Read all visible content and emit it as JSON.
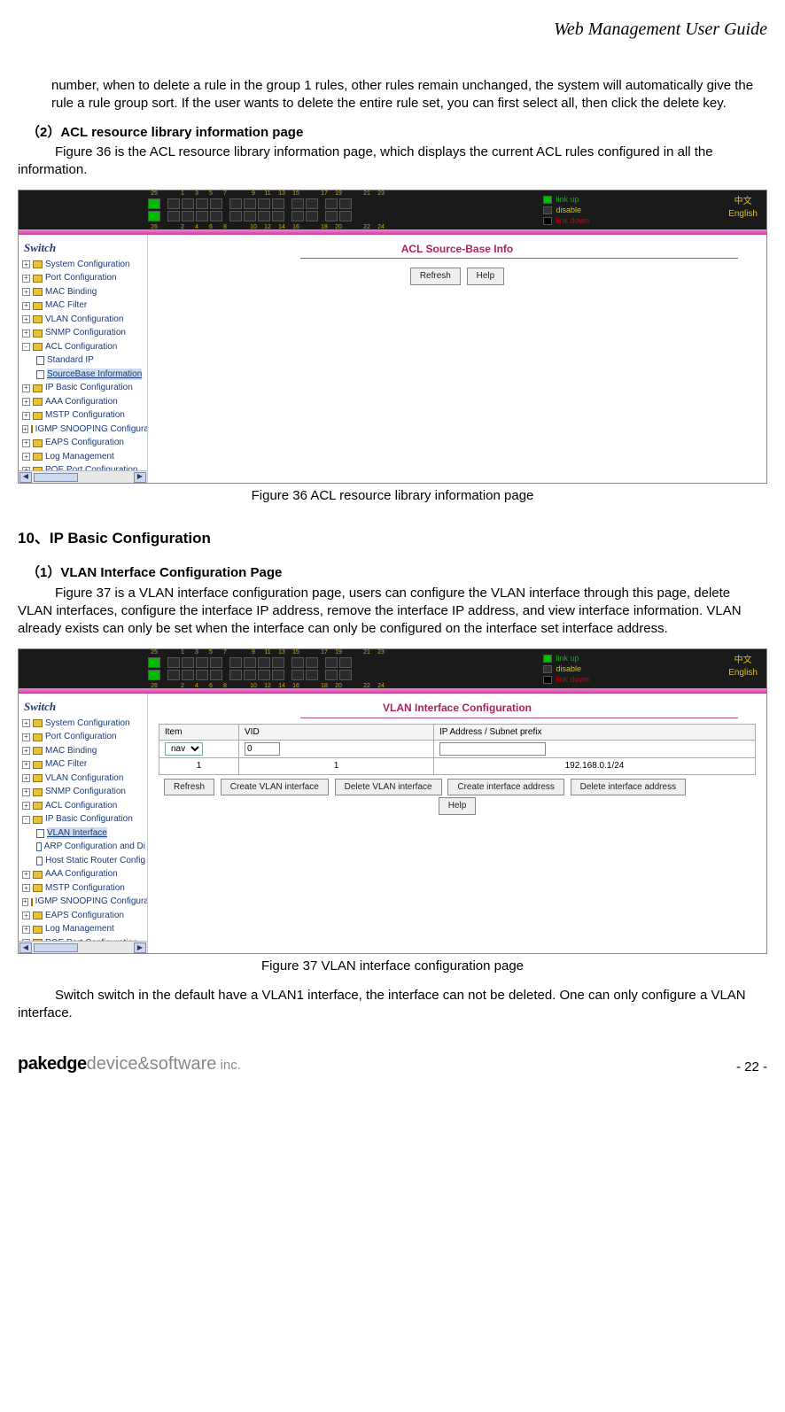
{
  "header": {
    "title": "Web Management User Guide"
  },
  "paragraphs": {
    "intro_cont": "number, when to delete a rule in the group 1 rules, other rules remain unchanged, the system will automatically give the rule a rule group sort. If the user wants to delete the entire rule set, you can first select all, then click the delete key.",
    "sec2_heading": "（2）ACL resource library information page",
    "sec2_body": "Figure 36 is the ACL resource library information page, which displays the current ACL rules configured in all the information.",
    "fig36_caption": "Figure 36    ACL resource library information page",
    "sec10_heading": "10、IP Basic Configuration",
    "sec10_1_heading": "（1）VLAN Interface Configuration Page",
    "sec10_1_body": "Figure 37 is a VLAN interface configuration page, users can configure the VLAN interface through this page, delete VLAN interfaces, configure the interface IP address, remove the interface IP address, and view interface information. VLAN already exists can only be set when the interface can only be configured on the interface set interface address.",
    "fig37_caption": "Figure 37    VLAN interface configuration page",
    "closing": "Switch switch in the default have a VLAN1 interface, the interface can not be deleted. One can only configure a VLAN interface."
  },
  "embedded_common": {
    "port_top_nums": [
      "25",
      "",
      "1",
      "3",
      "5",
      "7",
      "",
      "9",
      "11",
      "13",
      "15",
      "",
      "17",
      "19",
      "",
      "21",
      "23"
    ],
    "port_bot_nums": [
      "26",
      "",
      "2",
      "4",
      "6",
      "8",
      "",
      "10",
      "12",
      "14",
      "16",
      "",
      "18",
      "20",
      "",
      "22",
      "24"
    ],
    "legend": {
      "up": "link up",
      "disable": "disable",
      "down": "link down"
    },
    "lang_cn": "中文",
    "lang_en": "English",
    "sidebar_title": "Switch"
  },
  "fig36": {
    "panel_title": "ACL Source-Base Info",
    "buttons": {
      "refresh": "Refresh",
      "help": "Help"
    },
    "sidebar": [
      {
        "t": "folder",
        "exp": "+",
        "label": "System Configuration"
      },
      {
        "t": "folder",
        "exp": "+",
        "label": "Port Configuration"
      },
      {
        "t": "folder",
        "exp": "+",
        "label": "MAC Binding"
      },
      {
        "t": "folder",
        "exp": "+",
        "label": "MAC Filter"
      },
      {
        "t": "folder",
        "exp": "+",
        "label": "VLAN Configuration"
      },
      {
        "t": "folder",
        "exp": "+",
        "label": "SNMP Configuration"
      },
      {
        "t": "folder",
        "exp": "-",
        "label": "ACL Configuration"
      },
      {
        "t": "page",
        "sub": true,
        "label": "Standard IP"
      },
      {
        "t": "page",
        "sub": true,
        "label": "SourceBase Information",
        "selected": true
      },
      {
        "t": "folder",
        "exp": "+",
        "label": "IP Basic Configuration"
      },
      {
        "t": "folder",
        "exp": "+",
        "label": "AAA Configuration"
      },
      {
        "t": "folder",
        "exp": "+",
        "label": "MSTP Configuration"
      },
      {
        "t": "folder",
        "exp": "+",
        "label": "IGMP SNOOPING Configura"
      },
      {
        "t": "folder",
        "exp": "+",
        "label": "EAPS Configuration"
      },
      {
        "t": "folder",
        "exp": "+",
        "label": "Log Management"
      },
      {
        "t": "folder",
        "exp": "+",
        "label": "POE Port Configuration"
      }
    ]
  },
  "fig37": {
    "panel_title": "VLAN Interface Configuration",
    "table": {
      "headers": {
        "item": "Item",
        "vid": "VID",
        "ip": "IP Address / Subnet prefix"
      },
      "row_input": {
        "item_options": "nav",
        "vid": "0",
        "ip": ""
      },
      "row_data": {
        "item": "1",
        "vid": "1",
        "ip": "192.168.0.1/24"
      }
    },
    "buttons": {
      "refresh": "Refresh",
      "create_if": "Create VLAN interface",
      "delete_if": "Delete VLAN interface",
      "create_addr": "Create interface address",
      "delete_addr": "Delete interface address",
      "help": "Help"
    },
    "sidebar": [
      {
        "t": "folder",
        "exp": "+",
        "label": "System Configuration"
      },
      {
        "t": "folder",
        "exp": "+",
        "label": "Port Configuration"
      },
      {
        "t": "folder",
        "exp": "+",
        "label": "MAC Binding"
      },
      {
        "t": "folder",
        "exp": "+",
        "label": "MAC Filter"
      },
      {
        "t": "folder",
        "exp": "+",
        "label": "VLAN Configuration"
      },
      {
        "t": "folder",
        "exp": "+",
        "label": "SNMP Configuration"
      },
      {
        "t": "folder",
        "exp": "+",
        "label": "ACL Configuration"
      },
      {
        "t": "folder",
        "exp": "-",
        "label": "IP Basic Configuration"
      },
      {
        "t": "page",
        "sub": true,
        "label": "VLAN Interface",
        "selected": true
      },
      {
        "t": "page",
        "sub": true,
        "label": "ARP Configuration and Di"
      },
      {
        "t": "page",
        "sub": true,
        "label": "Host Static Router Config"
      },
      {
        "t": "folder",
        "exp": "+",
        "label": "AAA Configuration"
      },
      {
        "t": "folder",
        "exp": "+",
        "label": "MSTP Configuration"
      },
      {
        "t": "folder",
        "exp": "+",
        "label": "IGMP SNOOPING Configura"
      },
      {
        "t": "folder",
        "exp": "+",
        "label": "EAPS Configuration"
      },
      {
        "t": "folder",
        "exp": "+",
        "label": "Log Management"
      },
      {
        "t": "folder",
        "exp": "+",
        "label": "POE Port Configuration"
      }
    ]
  },
  "footer": {
    "brand_main": "pakedge",
    "brand_sub": "device&software",
    "brand_inc": " inc.",
    "page": "- 22 -"
  }
}
